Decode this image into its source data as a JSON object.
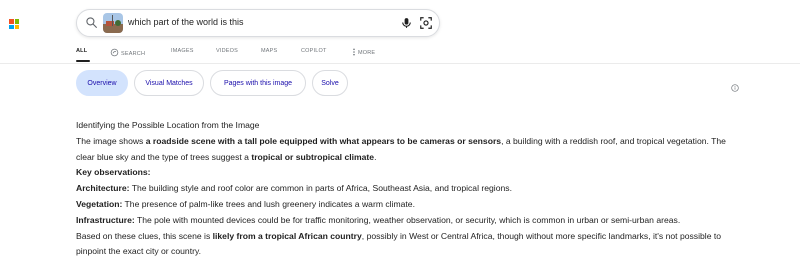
{
  "brand": {
    "logo_colors": [
      "#f25022",
      "#7fba00",
      "#00a4ef",
      "#ffb900"
    ]
  },
  "search": {
    "query": "which part of the world is this"
  },
  "tabs": [
    {
      "label": "ALL",
      "icon": ""
    },
    {
      "label": "SEARCH",
      "icon": "copilot-search-icon"
    },
    {
      "label": "IMAGES",
      "icon": ""
    },
    {
      "label": "VIDEOS",
      "icon": ""
    },
    {
      "label": "MAPS",
      "icon": ""
    },
    {
      "label": "COPILOT",
      "icon": ""
    },
    {
      "label": "MORE",
      "icon": "more-vertical-icon"
    }
  ],
  "chips": [
    {
      "label": "Overview",
      "active": true
    },
    {
      "label": "Visual Matches",
      "active": false
    },
    {
      "label": "Pages with this image",
      "active": false
    },
    {
      "label": "Solve",
      "active": false
    }
  ],
  "colors": {
    "accent": "#1a0dab",
    "chip_active_bg": "#d3e3fd"
  },
  "answer": {
    "heading": "Identifying the Possible Location from the Image",
    "p1_a": "The image shows ",
    "p1_b": "a roadside scene with a tall pole equipped with what appears to be cameras or sensors",
    "p1_c": ", a building with a reddish roof, and tropical vegetation. The clear blue sky and the type of trees suggest a ",
    "p1_d": "tropical or subtropical climate",
    "p1_e": ".",
    "key_obs": "Key observations:",
    "arch_label": "Architecture:",
    "arch_text": " The building style and roof color are common in parts of Africa, Southeast Asia, and tropical regions.",
    "veg_label": "Vegetation:",
    "veg_text": " The presence of palm-like trees and lush greenery indicates a warm climate.",
    "infra_label": "Infrastructure:",
    "infra_text": " The pole with mounted devices could be for traffic monitoring, weather observation, or security, which is common in urban or semi-urban areas.",
    "concl_a": "Based on these clues, this scene is ",
    "concl_b": "likely from a tropical African country",
    "concl_c": ", possibly in West or Central Africa, though without more specific landmarks, it's not possible to pinpoint the exact city or country."
  }
}
